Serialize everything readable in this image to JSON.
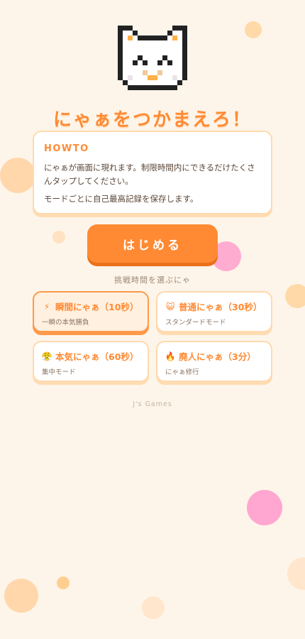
{
  "game": {
    "title": "にゃぁをつかまえろ！",
    "mascot_icon": "pixel-cat"
  },
  "howto": {
    "heading": "HOWTO",
    "line1": "にゃぁが画面に現れます。制限時間内にできるだけたくさんタップしてください。",
    "line2": "モードごとに自己最高記録を保存します。"
  },
  "start_button": {
    "label": "はじめる"
  },
  "mode_select": {
    "label": "挑戦時間を選ぶにゃ",
    "modes": [
      {
        "icon": "⚡",
        "icon_name": "lightning-icon",
        "title": "瞬間にゃぁ（10秒）",
        "subtitle": "一瞬の本気勝負",
        "selected": true
      },
      {
        "icon": "😺",
        "icon_name": "cat-face-icon",
        "title": "普通にゃぁ（30秒）",
        "subtitle": "スタンダードモード",
        "selected": false
      },
      {
        "icon": "😤",
        "icon_name": "huffing-face-icon",
        "title": "本気にゃぁ（60秒）",
        "subtitle": "集中モード",
        "selected": false
      },
      {
        "icon": "🔥",
        "icon_name": "fire-icon",
        "title": "廃人にゃぁ（3分）",
        "subtitle": "にゃぁ修行",
        "selected": false
      }
    ]
  },
  "footer": {
    "credit": "J's Games"
  },
  "colors": {
    "background": "#fef5ea",
    "accent": "#ff8a33",
    "pink_bubble": "#ff9fcd"
  }
}
